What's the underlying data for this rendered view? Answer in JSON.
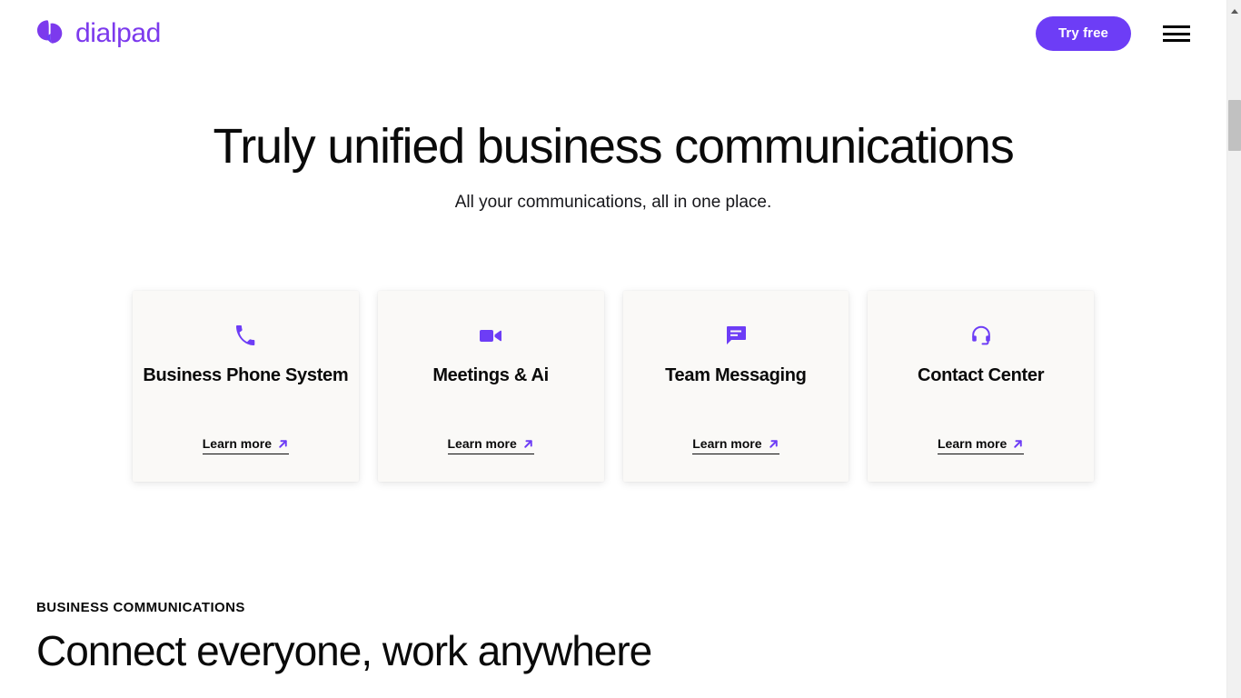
{
  "header": {
    "brand_name": "dialpad",
    "brand_icon": "dialpad-logo-icon",
    "cta_label": "Try free",
    "menu_icon": "hamburger-menu-icon"
  },
  "hero": {
    "title": "Truly unified business communications",
    "subtitle": "All your communications, all in one place."
  },
  "cards": [
    {
      "icon": "phone-icon",
      "title": "Business Phone System",
      "link_label": "Learn more",
      "link_icon": "arrow-up-right-icon"
    },
    {
      "icon": "video-camera-icon",
      "title": "Meetings & Ai",
      "link_label": "Learn more",
      "link_icon": "arrow-up-right-icon"
    },
    {
      "icon": "chat-message-icon",
      "title": "Team Messaging",
      "link_label": "Learn more",
      "link_icon": "arrow-up-right-icon"
    },
    {
      "icon": "headset-icon",
      "title": "Contact Center",
      "link_label": "Learn more",
      "link_icon": "arrow-up-right-icon"
    }
  ],
  "section": {
    "eyebrow": "BUSINESS COMMUNICATIONS",
    "title": "Connect everyone, work anywhere"
  },
  "scrollbar": {
    "up_arrow_icon": "scroll-up-arrow-icon"
  },
  "colors": {
    "brand_purple": "#6d3df6",
    "logo_purple": "#7c3aed",
    "card_background": "#faf9f7",
    "page_background": "#ffffff",
    "text_primary": "#0a0a0a"
  }
}
